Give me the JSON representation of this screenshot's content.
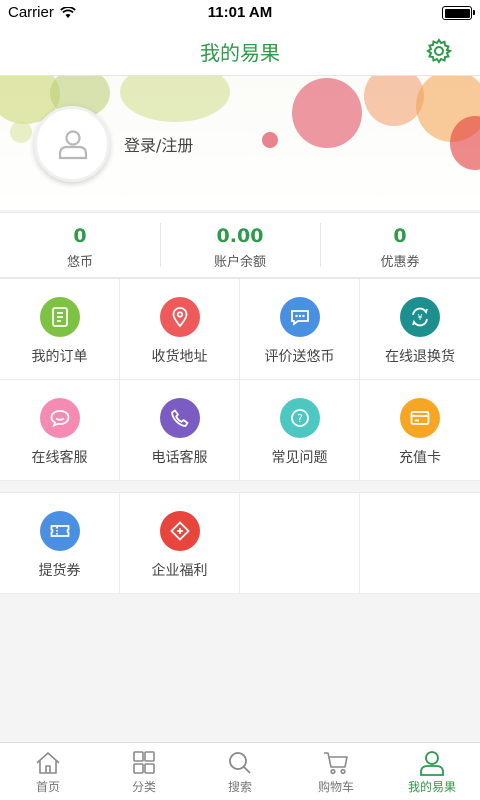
{
  "status_bar": {
    "carrier": "Carrier",
    "time": "11:01 AM"
  },
  "nav": {
    "title": "我的易果",
    "settings_icon": "gear-icon"
  },
  "profile": {
    "login_text": "登录/注册",
    "avatar_icon": "user-icon"
  },
  "stats": [
    {
      "value": "0",
      "label": "悠币"
    },
    {
      "value": "0.00",
      "label": "账户余额"
    },
    {
      "value": "0",
      "label": "优惠券"
    }
  ],
  "menu": [
    {
      "label": "我的订单",
      "icon": "order-icon",
      "color": "#7dc242"
    },
    {
      "label": "收货地址",
      "icon": "location-icon",
      "color": "#ee5a5a"
    },
    {
      "label": "评价送悠币",
      "icon": "comment-icon",
      "color": "#4a90e2"
    },
    {
      "label": "在线退换货",
      "icon": "exchange-icon",
      "color": "#1d8f8f"
    },
    {
      "label": "在线客服",
      "icon": "chat-icon",
      "color": "#f58bb3"
    },
    {
      "label": "电话客服",
      "icon": "phone-icon",
      "color": "#7b5cc2"
    },
    {
      "label": "常见问题",
      "icon": "question-icon",
      "color": "#4dc7c2"
    },
    {
      "label": "充值卡",
      "icon": "card-icon",
      "color": "#f6a623"
    }
  ],
  "extra": [
    {
      "label": "提货券",
      "icon": "ticket-icon",
      "color": "#4a90e2"
    },
    {
      "label": "企业福利",
      "icon": "gift-icon",
      "color": "#e8453c"
    }
  ],
  "tabs": [
    {
      "label": "首页",
      "icon": "home-icon",
      "active": false
    },
    {
      "label": "分类",
      "icon": "category-icon",
      "active": false
    },
    {
      "label": "搜索",
      "icon": "search-icon",
      "active": false
    },
    {
      "label": "购物车",
      "icon": "cart-icon",
      "active": false
    },
    {
      "label": "我的易果",
      "icon": "profile-icon",
      "active": true
    }
  ],
  "colors": {
    "accent": "#2e9a4a"
  }
}
